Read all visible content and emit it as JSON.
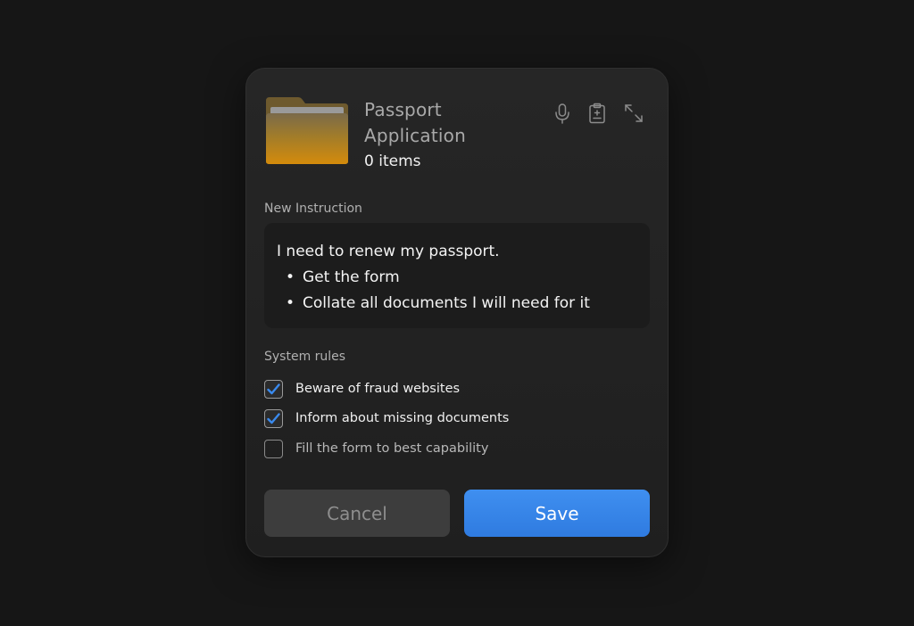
{
  "folder": {
    "title": "Passport Application",
    "item_count": "0 items"
  },
  "header_icons": [
    "microphone-icon",
    "clipboard-icon",
    "expand-icon"
  ],
  "instruction": {
    "label": "New Instruction",
    "lead": "I need to renew my passport.",
    "bullets": [
      "Get the form",
      "Collate all documents I will need for it"
    ]
  },
  "rules": {
    "label": "System rules",
    "items": [
      {
        "label": "Beware of fraud websites",
        "checked": true
      },
      {
        "label": "Inform about missing documents",
        "checked": true
      },
      {
        "label": "Fill the form to best capability",
        "checked": false
      }
    ]
  },
  "buttons": {
    "cancel": "Cancel",
    "save": "Save"
  },
  "colors": {
    "accent": "#3a8aee",
    "folder": "#d28a10",
    "background": "#161616"
  }
}
